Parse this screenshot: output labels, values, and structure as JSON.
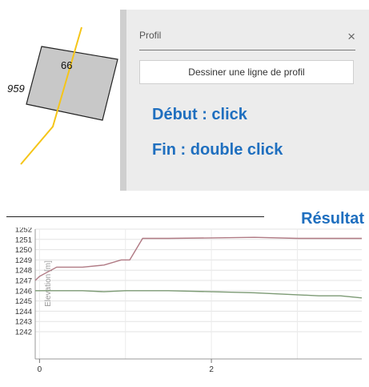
{
  "map": {
    "parcel_number": "66",
    "parcel_neighbor": "959",
    "colors": {
      "parcel_fill": "#c8c8c8",
      "profile_line": "#f5c518"
    }
  },
  "panel": {
    "title": "Profil",
    "close_glyph": "×",
    "draw_button_label": "Dessiner une ligne de profil",
    "instruction_start": "Début : click",
    "instruction_end": "Fin : double click"
  },
  "result": {
    "label": "Résultat"
  },
  "chart_data": {
    "type": "line",
    "ylabel": "Elevation [m]",
    "xlabel": "",
    "ylim": [
      1242,
      1252
    ],
    "xlim": [
      -0.05,
      3.75
    ],
    "y_ticks": [
      "1252",
      "1251",
      "1250",
      "1249",
      "1248",
      "1247",
      "1246",
      "1245",
      "1244",
      "1243",
      "1242"
    ],
    "x_ticks": [
      "0",
      "2"
    ],
    "grid": true,
    "series": [
      {
        "color": "#b07a84",
        "x": [
          -0.05,
          0.0,
          0.2,
          0.5,
          0.75,
          0.95,
          1.05,
          1.2,
          1.5,
          2.0,
          2.5,
          3.0,
          3.5,
          3.75
        ],
        "y": [
          1247.0,
          1247.4,
          1248.3,
          1248.3,
          1248.5,
          1249.0,
          1249.0,
          1251.1,
          1251.1,
          1251.15,
          1251.2,
          1251.1,
          1251.1,
          1251.1
        ]
      },
      {
        "color": "#7c9a74",
        "x": [
          -0.05,
          0.0,
          0.5,
          0.75,
          1.0,
          1.5,
          2.0,
          2.5,
          3.0,
          3.25,
          3.5,
          3.75
        ],
        "y": [
          1246.0,
          1246.0,
          1246.0,
          1245.9,
          1246.0,
          1246.0,
          1245.9,
          1245.8,
          1245.6,
          1245.5,
          1245.5,
          1245.3
        ]
      }
    ]
  }
}
